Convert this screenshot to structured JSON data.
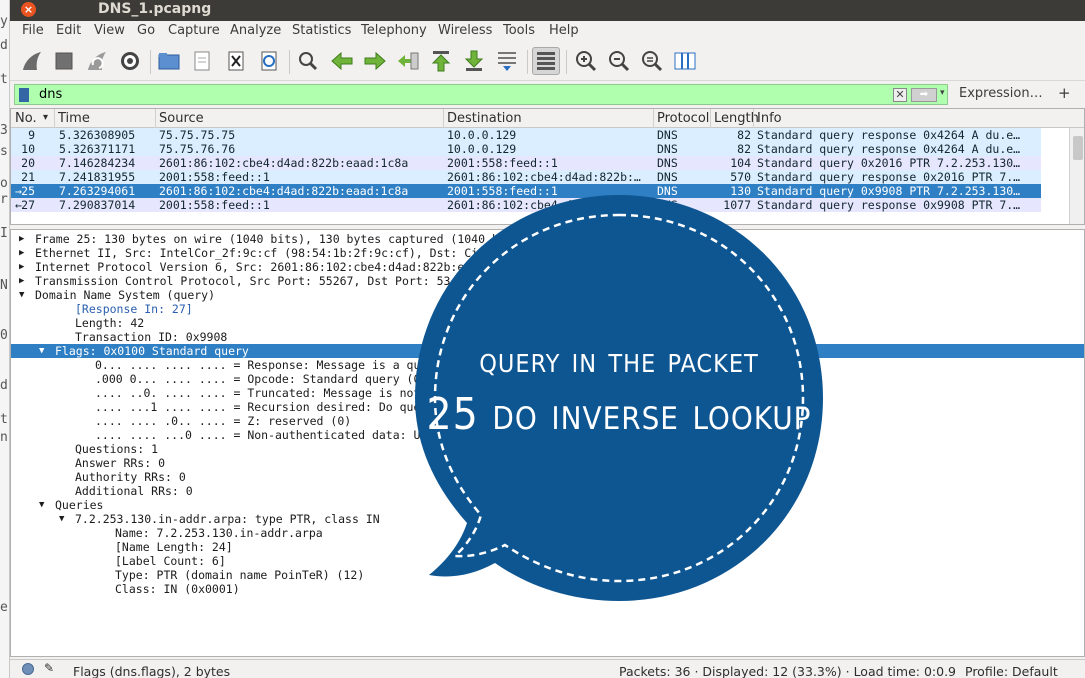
{
  "window": {
    "title": "DNS_1.pcapng",
    "close_glyph": "×"
  },
  "left_strip_chars": [
    "y",
    "d",
    "t",
    "3",
    "s",
    "o",
    "r",
    "I",
    "N",
    "0",
    "d",
    "t",
    "n",
    "er"
  ],
  "menu": [
    "File",
    "Edit",
    "View",
    "Go",
    "Capture",
    "Analyze",
    "Statistics",
    "Telephony",
    "Wireless",
    "Tools",
    "Help"
  ],
  "toolbar_icons": [
    "shark-fin-start-icon",
    "stop-square-icon",
    "restart-fin-icon",
    "capture-options-gear-icon",
    "open-folder-icon",
    "save-file-icon",
    "close-file-icon",
    "reload-icon",
    "find-packet-icon",
    "go-back-icon",
    "go-forward-icon",
    "go-to-packet-icon",
    "go-first-icon",
    "go-last-icon",
    "auto-scroll-icon",
    "colorize-icon",
    "zoom-in-icon",
    "zoom-out-icon",
    "zoom-normal-icon",
    "resize-columns-icon"
  ],
  "filter": {
    "value": "dns",
    "clear": "✕",
    "apply": "➡",
    "dropdown": "▾",
    "expression_label": "Expression…",
    "plus_label": "+"
  },
  "packet_list": {
    "columns": [
      "No.",
      "Time",
      "Source",
      "Destination",
      "Protocol",
      "Length",
      "Info"
    ],
    "sort_arrow": "▾",
    "rows": [
      {
        "no": "9",
        "time": "5.326308905",
        "src": "75.75.75.75",
        "dst": "10.0.0.129",
        "proto": "DNS",
        "len": "82",
        "info": "Standard query response 0x4264 A du.e…",
        "marker": ""
      },
      {
        "no": "10",
        "time": "5.326371171",
        "src": "75.75.76.76",
        "dst": "10.0.0.129",
        "proto": "DNS",
        "len": "82",
        "info": "Standard query response 0x4264 A du.e…",
        "marker": ""
      },
      {
        "no": "20",
        "time": "7.146284234",
        "src": "2601:86:102:cbe4:d4ad:822b:eaad:1c8a",
        "dst": "2001:558:feed::1",
        "proto": "DNS",
        "len": "104",
        "info": "Standard query 0x2016 PTR 7.2.253.130…",
        "marker": ""
      },
      {
        "no": "21",
        "time": "7.241831955",
        "src": "2001:558:feed::1",
        "dst": "2601:86:102:cbe4:d4ad:822b:…",
        "proto": "DNS",
        "len": "570",
        "info": "Standard query response 0x2016 PTR 7.…",
        "marker": ""
      },
      {
        "no": "25",
        "time": "7.263294061",
        "src": "2601:86:102:cbe4:d4ad:822b:eaad:1c8a",
        "dst": "2001:558:feed::1",
        "proto": "DNS",
        "len": "130",
        "info": "Standard query 0x9908 PTR 7.2.253.130…",
        "marker": "→"
      },
      {
        "no": "27",
        "time": "7.290837014",
        "src": "2001:558:feed::1",
        "dst": "2601:86:102:cbe4:d4ad:822b:…",
        "proto": "DNS",
        "len": "1077",
        "info": "Standard query response 0x9908 PTR 7.…",
        "marker": "←"
      }
    ]
  },
  "details": [
    {
      "tri": "▶",
      "text": "Frame 25: 130 bytes on wire (1040 bits), 130 bytes captured (1040 bits) on interface 0",
      "indent": 0,
      "style": ""
    },
    {
      "tri": "▶",
      "text": "Ethernet II, Src: IntelCor_2f:9c:cf (98:54:1b:2f:9c:cf), Dst: Cisco_ab:3f:41",
      "indent": 0,
      "style": ""
    },
    {
      "tri": "▶",
      "text": "Internet Protocol Version 6, Src: 2601:86:102:cbe4:d4ad:822b:eaad:1c8a",
      "indent": 0,
      "style": ""
    },
    {
      "tri": "▶",
      "text": "Transmission Control Protocol, Src Port: 55267, Dst Port: 53",
      "indent": 0,
      "style": ""
    },
    {
      "tri": "▼",
      "text": "Domain Name System (query)",
      "indent": 0,
      "style": ""
    },
    {
      "tri": "",
      "text": "[Response In: 27]",
      "indent": 2,
      "style": "link"
    },
    {
      "tri": "",
      "text": "Length: 42",
      "indent": 2,
      "style": ""
    },
    {
      "tri": "",
      "text": "Transaction ID: 0x9908",
      "indent": 2,
      "style": ""
    },
    {
      "tri": "▼",
      "text": "Flags: 0x0100 Standard query",
      "indent": 1,
      "style": "sel"
    },
    {
      "tri": "",
      "text": "0... .... .... .... = Response: Message is a query",
      "indent": 3,
      "style": ""
    },
    {
      "tri": "",
      "text": ".000 0... .... .... = Opcode: Standard query (0)",
      "indent": 3,
      "style": ""
    },
    {
      "tri": "",
      "text": ".... ..0. .... .... = Truncated: Message is not truncated",
      "indent": 3,
      "style": ""
    },
    {
      "tri": "",
      "text": ".... ...1 .... .... = Recursion desired: Do query recursively",
      "indent": 3,
      "style": ""
    },
    {
      "tri": "",
      "text": ".... .... .0.. .... = Z: reserved (0)",
      "indent": 3,
      "style": ""
    },
    {
      "tri": "",
      "text": ".... .... ...0 .... = Non-authenticated data: Unacceptable",
      "indent": 3,
      "style": ""
    },
    {
      "tri": "",
      "text": "Questions: 1",
      "indent": 2,
      "style": ""
    },
    {
      "tri": "",
      "text": "Answer RRs: 0",
      "indent": 2,
      "style": ""
    },
    {
      "tri": "",
      "text": "Authority RRs: 0",
      "indent": 2,
      "style": ""
    },
    {
      "tri": "",
      "text": "Additional RRs: 0",
      "indent": 2,
      "style": ""
    },
    {
      "tri": "▼",
      "text": "Queries",
      "indent": 1,
      "style": ""
    },
    {
      "tri": "▼",
      "text": "7.2.253.130.in-addr.arpa: type PTR, class IN",
      "indent": 2,
      "style": ""
    },
    {
      "tri": "",
      "text": "Name: 7.2.253.130.in-addr.arpa",
      "indent": 4,
      "style": ""
    },
    {
      "tri": "",
      "text": "[Name Length: 24]",
      "indent": 4,
      "style": ""
    },
    {
      "tri": "",
      "text": "[Label Count: 6]",
      "indent": 4,
      "style": ""
    },
    {
      "tri": "",
      "text": "Type: PTR (domain name PoinTeR) (12)",
      "indent": 4,
      "style": ""
    },
    {
      "tri": "",
      "text": "Class: IN (0x0001)",
      "indent": 4,
      "style": ""
    }
  ],
  "status": {
    "field": "Flags (dns.flags), 2 bytes",
    "packets": "Packets: 36 · Displayed: 12 (33.3%) · Load time: 0:0.9",
    "profile": "Profile: Default"
  },
  "annotation": {
    "line1": "query in the packet",
    "line2": "25 do inverse lookup",
    "color": "#0e5692"
  },
  "colors": {
    "selected": "#2f7fc4",
    "filter_ok": "#afffaf",
    "row_udp": "#daeeff",
    "row_tcp": "#e7e6ff"
  }
}
